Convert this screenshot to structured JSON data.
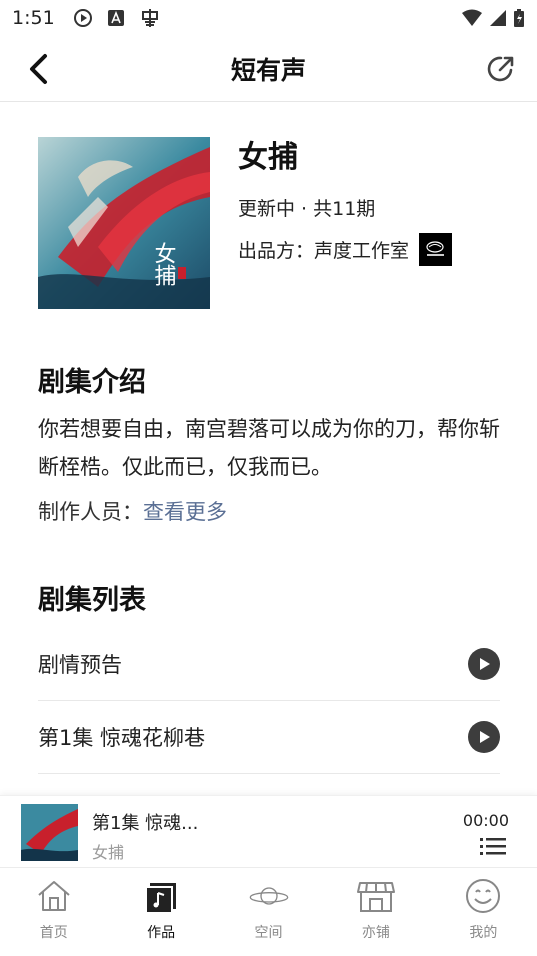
{
  "status_bar": {
    "time": "1:51"
  },
  "header": {
    "title": "短有声"
  },
  "drama": {
    "title": "女捕",
    "status": "更新中 · 共11期",
    "producer_label": "出品方：",
    "producer": "声度工作室",
    "cover_text": "女捕"
  },
  "intro": {
    "heading": "剧集介绍",
    "text": "你若想要自由，南宫碧落可以成为你的刀，帮你斩断桎梏。仅此而已，仅我而已。",
    "staff_label": "制作人员：",
    "staff_link": "查看更多"
  },
  "episodes": {
    "heading": "剧集列表",
    "items": [
      {
        "title": "剧情预告"
      },
      {
        "title": "第1集 惊魂花柳巷"
      }
    ]
  },
  "mini_player": {
    "title": "第1集 惊魂...",
    "subtitle": "女捕",
    "time": "00:00"
  },
  "tabs": [
    {
      "label": "首页",
      "icon": "home-icon",
      "active": false
    },
    {
      "label": "作品",
      "icon": "music-note-icon",
      "active": true
    },
    {
      "label": "空间",
      "icon": "planet-icon",
      "active": false
    },
    {
      "label": "亦铺",
      "icon": "shop-icon",
      "active": false
    },
    {
      "label": "我的",
      "icon": "smile-icon",
      "active": false
    }
  ],
  "colors": {
    "accent_link": "#5a6f94",
    "play_button": "#3d3d3d",
    "cover_red": "#c8202c",
    "cover_teal": "#3b8aa0"
  }
}
